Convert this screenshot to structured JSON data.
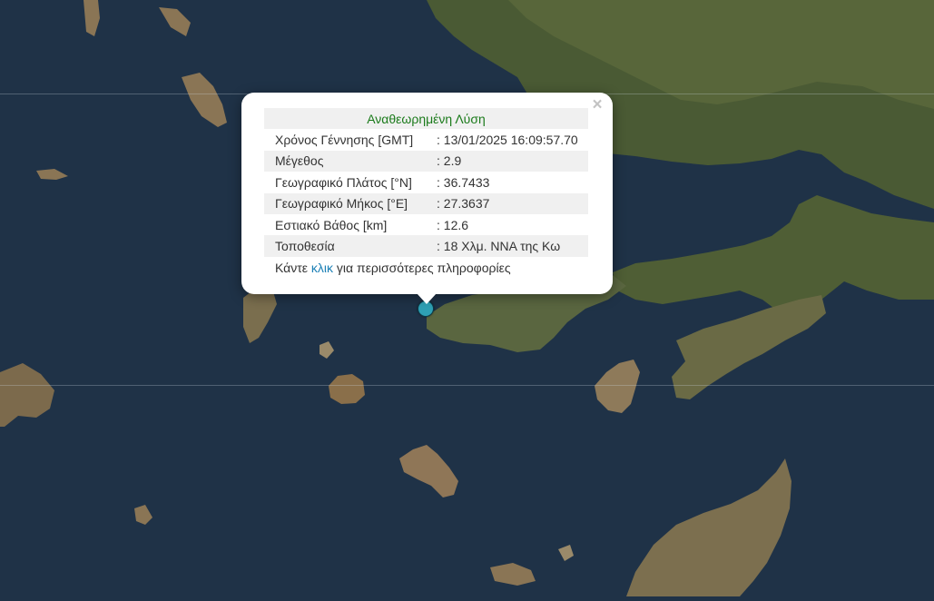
{
  "map": {
    "colors": {
      "sea": "#1f3247",
      "land_dark": "#3b4a2e",
      "land_mid": "#596a3e",
      "land_light": "#8b7a57",
      "marker": "#2ea0b4",
      "heading_green": "#1a7a1a",
      "link_blue": "#1b7fb5"
    }
  },
  "popup": {
    "heading": "Αναθεωρημένη Λύση",
    "close_icon": "×",
    "rows": [
      {
        "label": "Χρόνος Γέννησης [GMT]",
        "value": ": 13/01/2025 16:09:57.70"
      },
      {
        "label": "Μέγεθος",
        "value": ": 2.9"
      },
      {
        "label": "Γεωγραφικό Πλάτος [°N]",
        "value": ": 36.7433"
      },
      {
        "label": "Γεωγραφικό Μήκος [°E]",
        "value": ": 27.3637"
      },
      {
        "label": "Εστιακό Βάθος [km]",
        "value": ": 12.6"
      },
      {
        "label": "Τοποθεσία",
        "value": ": 18 Χλμ. ΝΝΑ της Κω"
      }
    ],
    "more_prefix": "Κάντε ",
    "more_link": "κλικ",
    "more_suffix": " για περισσότερες πληροφορίες"
  }
}
